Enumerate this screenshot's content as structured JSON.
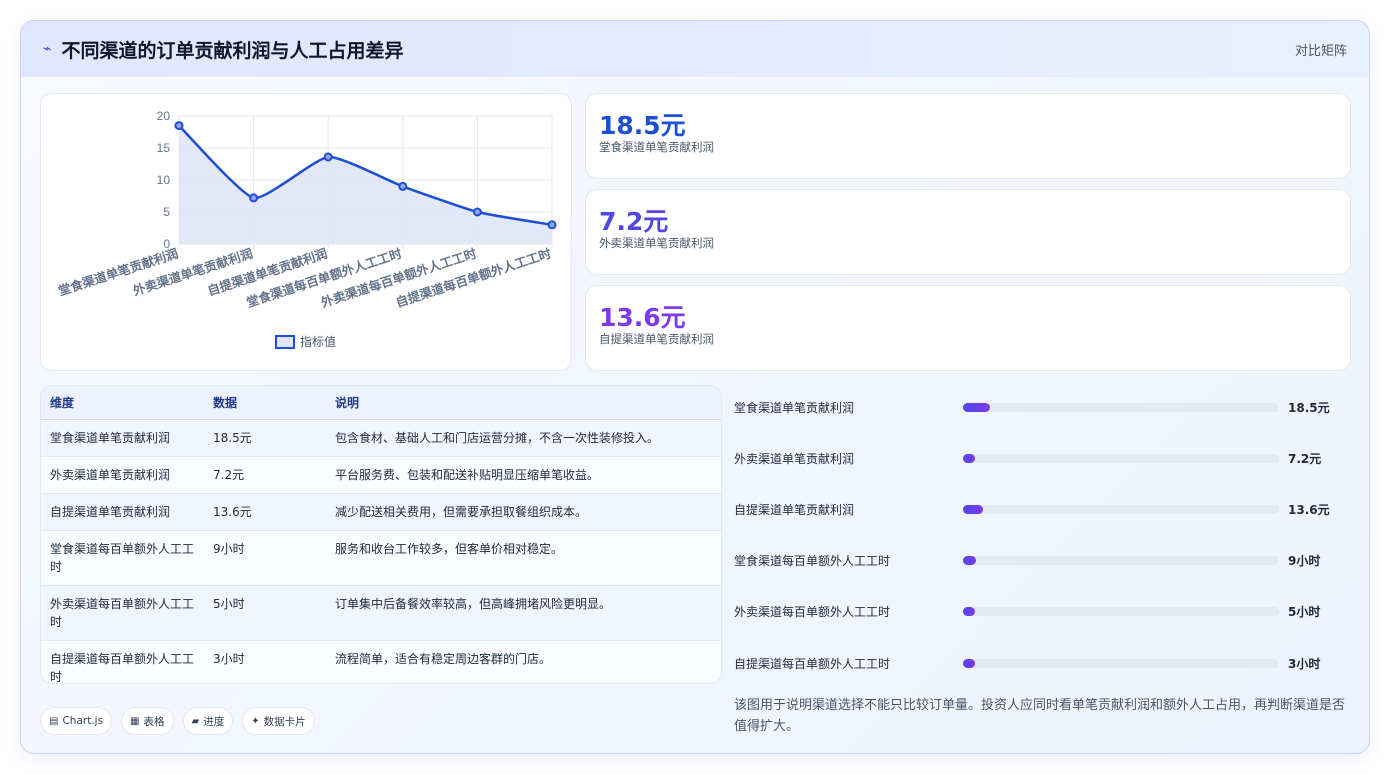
{
  "header": {
    "icon": "chart-line-icon",
    "title": "不同渠道的订单贡献利润与人工占用差异",
    "tag": "对比矩阵"
  },
  "chart_data": {
    "type": "line",
    "categories": [
      "堂食渠道单笔贡献利润",
      "外卖渠道单笔贡献利润",
      "自提渠道单笔贡献利润",
      "堂食渠道每百单额外人工工时",
      "外卖渠道每百单额外人工工时",
      "自提渠道每百单额外人工工时"
    ],
    "series": [
      {
        "name": "指标值",
        "values": [
          18.5,
          7.2,
          13.6,
          9,
          5,
          3
        ]
      }
    ],
    "ylim": [
      0,
      20
    ],
    "yticks": [
      0,
      5,
      10,
      15,
      20
    ],
    "grid": true,
    "legend": "bottom",
    "colors": {
      "line": "#1d4ed8",
      "fill": "#dfe5f7"
    }
  },
  "stats": [
    {
      "value": "18.5元",
      "label": "堂食渠道单笔贡献利润",
      "color": "#1d4ed8"
    },
    {
      "value": "7.2元",
      "label": "外卖渠道单笔贡献利润",
      "color": "#4f46e5"
    },
    {
      "value": "13.6元",
      "label": "自提渠道单笔贡献利润",
      "color": "#7c3aed"
    }
  ],
  "table": {
    "headers": [
      "维度",
      "数据",
      "说明"
    ],
    "rows": [
      [
        "堂食渠道单笔贡献利润",
        "18.5元",
        "包含食材、基础人工和门店运营分摊，不含一次性装修投入。"
      ],
      [
        "外卖渠道单笔贡献利润",
        "7.2元",
        "平台服务费、包装和配送补贴明显压缩单笔收益。"
      ],
      [
        "自提渠道单笔贡献利润",
        "13.6元",
        "减少配送相关费用，但需要承担取餐组织成本。"
      ],
      [
        "堂食渠道每百单额外人工工时",
        "9小时",
        "服务和收台工作较多，但客单价相对稳定。"
      ],
      [
        "外卖渠道每百单额外人工工时",
        "5小时",
        "订单集中后备餐效率较高，但高峰拥堵风险更明显。"
      ],
      [
        "自提渠道每百单额外人工工时",
        "3小时",
        "流程简单，适合有稳定周边客群的门店。"
      ]
    ]
  },
  "progress": [
    {
      "label": "堂食渠道单笔贡献利润",
      "value": "18.5元",
      "fraction": 0.085
    },
    {
      "label": "外卖渠道单笔贡献利润",
      "value": "7.2元",
      "fraction": 0.033
    },
    {
      "label": "自提渠道单笔贡献利润",
      "value": "13.6元",
      "fraction": 0.062
    },
    {
      "label": "堂食渠道每百单额外人工工时",
      "value": "9小时",
      "fraction": 0.041
    },
    {
      "label": "外卖渠道每百单额外人工工时",
      "value": "5小时",
      "fraction": 0.023
    },
    {
      "label": "自提渠道每百单额外人工工时",
      "value": "3小时",
      "fraction": 0.014
    }
  ],
  "note": "该图用于说明渠道选择不能只比较订单量。投资人应同时看单笔贡献利润和额外人工占用，再判断渠道是否值得扩大。",
  "chips": [
    {
      "icon": "chart-icon",
      "label": "Chart.js"
    },
    {
      "icon": "table-icon",
      "label": "表格"
    },
    {
      "icon": "progress-icon",
      "label": "进度"
    },
    {
      "icon": "sparkle-icon",
      "label": "数据卡片"
    }
  ]
}
